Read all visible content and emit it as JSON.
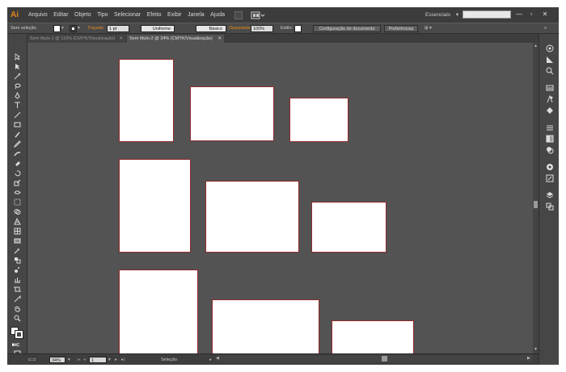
{
  "app": {
    "logo": "Ai"
  },
  "menubar": {
    "items": [
      "Arquivo",
      "Editar",
      "Objeto",
      "Tipo",
      "Selecionar",
      "Efeito",
      "Exibir",
      "Janela",
      "Ajuda"
    ],
    "workspace": "Essenciais",
    "workspace_chevron": "▾",
    "window_controls": [
      "—",
      "▫",
      "✕"
    ]
  },
  "controlbar": {
    "selection_label": "Sem seleção",
    "stroke_label": "Traçado",
    "stroke_weight": "1 pt",
    "profile_uniform": "Uniforme",
    "brush_basic": "Básico",
    "opacity_label": "Opacidade:",
    "opacity_value": "100%",
    "style_label": "Estilo:",
    "doc_setup_button": "Configuração de documento",
    "preferences_button": "Preferências"
  },
  "tabs": [
    {
      "label": "Sem título-1 @ 119% (CMYK/Visualização)",
      "close": "✕",
      "active": false
    },
    {
      "label": "Sem título-2 @ 34% (CMYK/Visualização)",
      "close": "✕",
      "active": true
    }
  ],
  "artboards": {
    "count": 9,
    "fill": "#ffffff",
    "border": "#8f2b2b"
  },
  "statusbar": {
    "zoom": "34%",
    "artboard_number": "1",
    "status_text": "Seleção"
  },
  "colors": {
    "background": "#535353",
    "panel": "#464646",
    "menubar": "#3c3c3c",
    "accent": "#e8891b"
  }
}
